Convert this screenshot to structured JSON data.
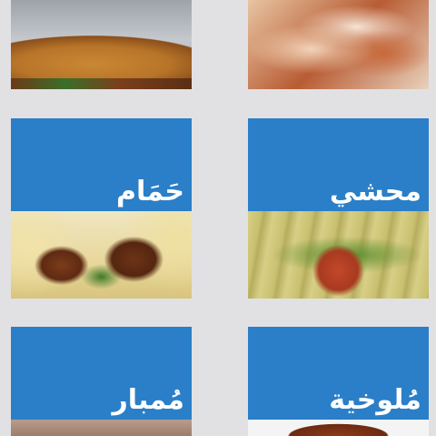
{
  "tiles": [
    {
      "id": "sandwich",
      "label": ""
    },
    {
      "id": "kunafa",
      "label": ""
    },
    {
      "id": "hamam",
      "label": "حَمَام"
    },
    {
      "id": "mahshi",
      "label": "محشي"
    },
    {
      "id": "mumbar",
      "label": "مُمبار"
    },
    {
      "id": "mulukhiya",
      "label": "مُلوخية"
    }
  ],
  "colors": {
    "tile_blue": "#2a7fc8",
    "background": "#e1e1e3"
  }
}
